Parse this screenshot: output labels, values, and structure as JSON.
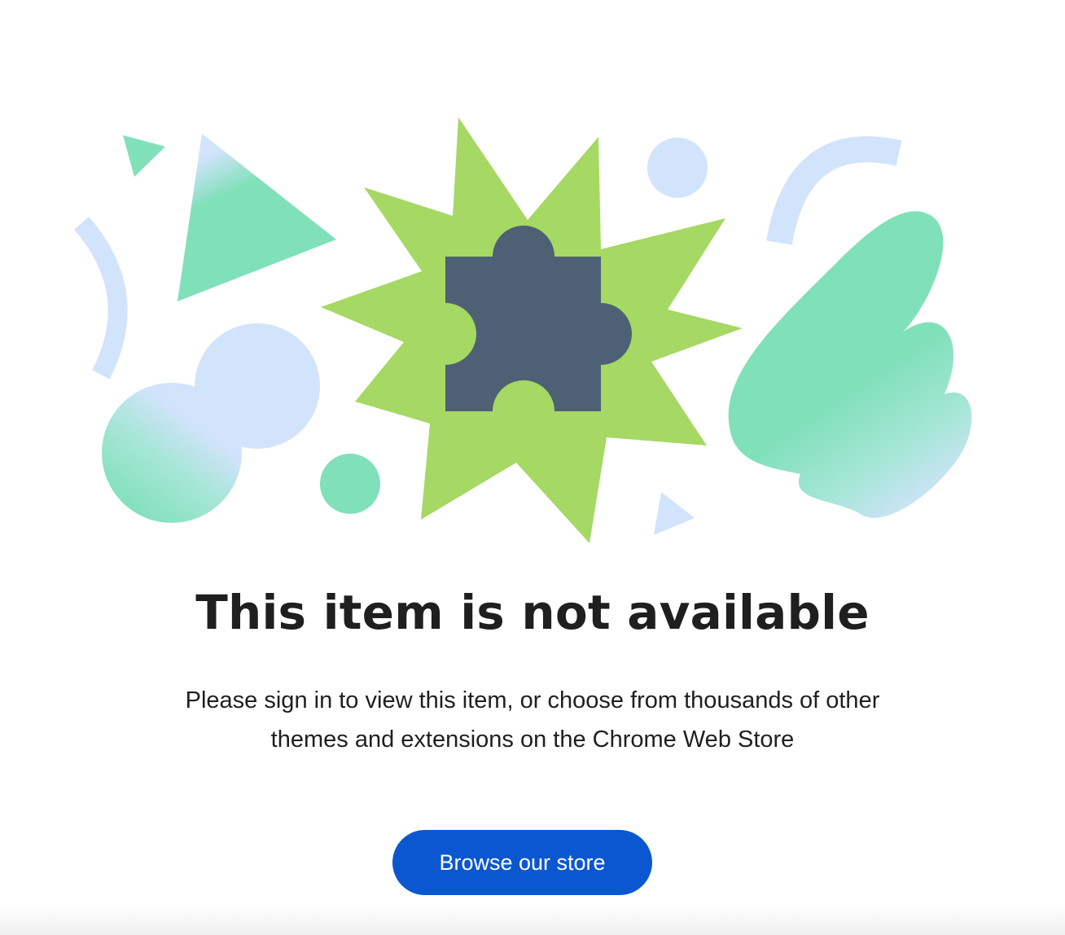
{
  "page": {
    "title": "This item is not available",
    "message": "Please sign in to view this item, or choose from thousands of other themes and extensions on the Chrome Web Store",
    "button_label": "Browse our store"
  },
  "illustration": {
    "center_icon": "puzzle-piece-icon",
    "colors": {
      "burst_green": "#a6d864",
      "puzzle_slate": "#4e6174",
      "mint": "#80e0ba",
      "light_blue": "#d2e3fc",
      "button_blue": "#0b57d0"
    }
  }
}
